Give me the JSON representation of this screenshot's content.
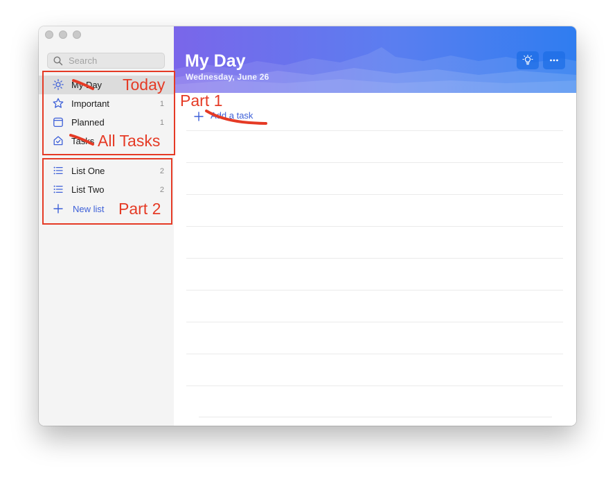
{
  "window": {
    "traffic_lights": [
      "close",
      "minimize",
      "zoom"
    ]
  },
  "search": {
    "placeholder": "Search",
    "value": ""
  },
  "sidebar": {
    "smart_lists": [
      {
        "icon": "sun-icon",
        "label": "My Day",
        "count": "",
        "active": true
      },
      {
        "icon": "star-icon",
        "label": "Important",
        "count": "1",
        "active": false
      },
      {
        "icon": "calendar-icon",
        "label": "Planned",
        "count": "1",
        "active": false
      },
      {
        "icon": "home-icon",
        "label": "Tasks",
        "count": "",
        "active": false
      }
    ],
    "lists": [
      {
        "icon": "list-icon",
        "label": "List One",
        "count": "2"
      },
      {
        "icon": "list-icon",
        "label": "List Two",
        "count": "2"
      }
    ],
    "new_list": {
      "icon": "plus-icon",
      "label": "New list"
    }
  },
  "main": {
    "title": "My Day",
    "date": "Wednesday, June 26",
    "header_buttons": [
      "lightbulb-icon",
      "more-icon"
    ],
    "add_task": {
      "icon": "plus-icon",
      "label": "Add a task"
    }
  },
  "annotations": {
    "today": "Today",
    "all_tasks": "All Tasks",
    "part1": "Part 1",
    "part2": "Part 2"
  },
  "colors": {
    "accent": "#3c5fd8",
    "annotation": "#e53a25",
    "header_start": "#7a66ea",
    "header_end": "#2f7df0"
  }
}
